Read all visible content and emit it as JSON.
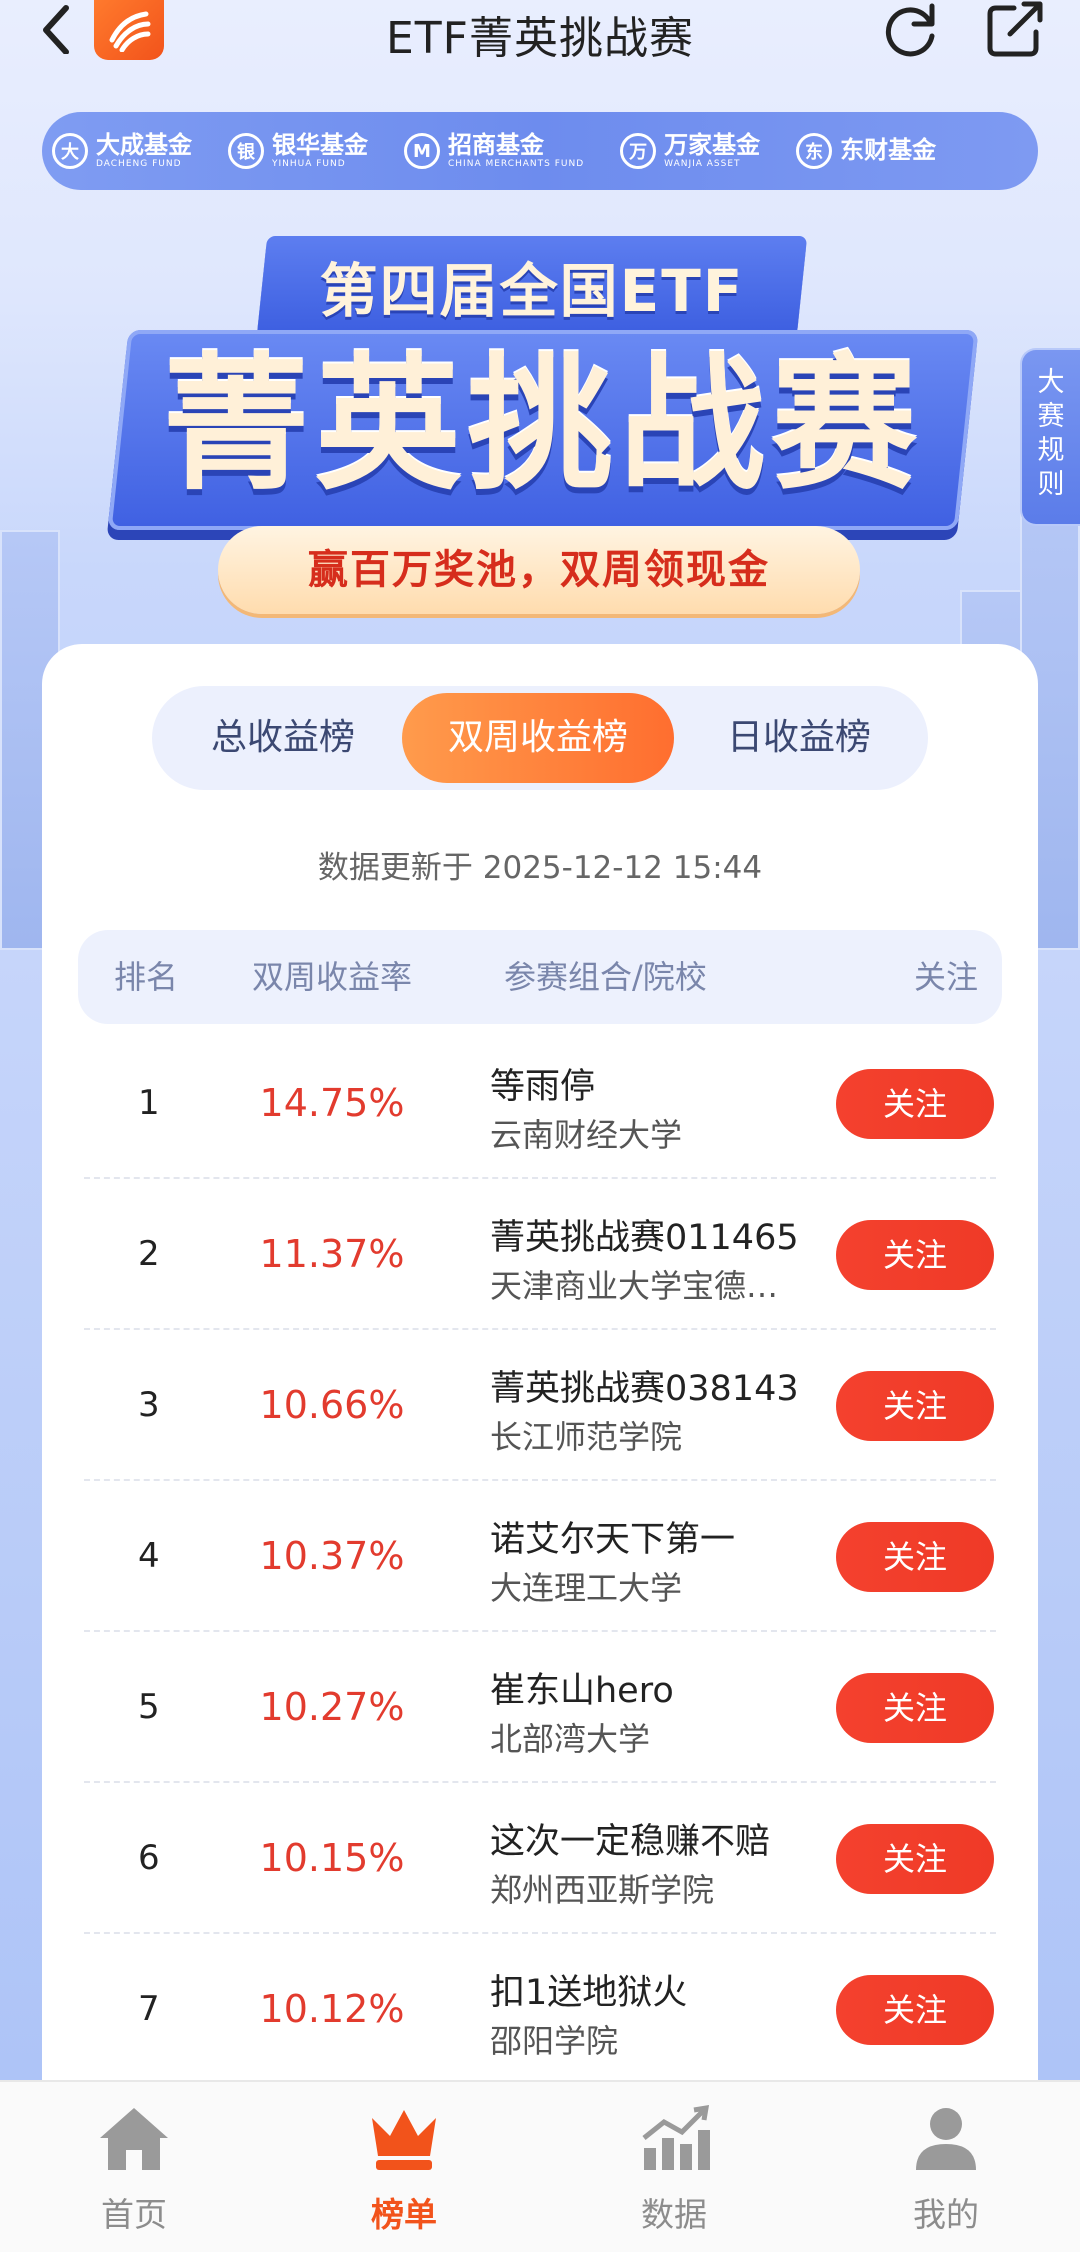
{
  "header": {
    "title": "ETF菁英挑战赛"
  },
  "sponsors": [
    {
      "cn": "大成基金",
      "en": "DACHENG FUND",
      "icon": "大"
    },
    {
      "cn": "银华基金",
      "en": "YINHUA FUND",
      "icon": "银"
    },
    {
      "cn": "招商基金",
      "en": "CHINA MERCHANTS FUND",
      "icon": "M"
    },
    {
      "cn": "万家基金",
      "en": "WANJIA ASSET",
      "icon": "万"
    },
    {
      "cn": "东财基金",
      "en": "",
      "icon": "东"
    }
  ],
  "banner": {
    "edition": "第四届全国ETF",
    "main": "菁英挑战赛",
    "slogan": "赢百万奖池，双周领现金",
    "rules_tab": "大赛规则"
  },
  "tabs": [
    {
      "label": "总收益榜",
      "active": false
    },
    {
      "label": "双周收益榜",
      "active": true
    },
    {
      "label": "日收益榜",
      "active": false
    }
  ],
  "update_note": "数据更新于 2025-12-12 15:44",
  "table": {
    "headers": {
      "rank": "排名",
      "return": "双周收益率",
      "team": "参赛组合/院校",
      "follow": "关注"
    },
    "rows": [
      {
        "rank": "1",
        "return": "14.75%",
        "team": "等雨停",
        "school": "云南财经大学",
        "follow": "关注"
      },
      {
        "rank": "2",
        "return": "11.37%",
        "team": "菁英挑战赛011465",
        "school": "天津商业大学宝德…",
        "follow": "关注"
      },
      {
        "rank": "3",
        "return": "10.66%",
        "team": "菁英挑战赛038143",
        "school": "长江师范学院",
        "follow": "关注"
      },
      {
        "rank": "4",
        "return": "10.37%",
        "team": "诺艾尔天下第一",
        "school": "大连理工大学",
        "follow": "关注"
      },
      {
        "rank": "5",
        "return": "10.27%",
        "team": "崔东山hero",
        "school": "北部湾大学",
        "follow": "关注"
      },
      {
        "rank": "6",
        "return": "10.15%",
        "team": "这次一定稳赚不赔",
        "school": "郑州西亚斯学院",
        "follow": "关注"
      },
      {
        "rank": "7",
        "return": "10.12%",
        "team": "扣1送地狱火",
        "school": "邵阳学院",
        "follow": "关注"
      }
    ]
  },
  "bottom_nav": [
    {
      "label": "首页",
      "icon": "home-icon",
      "active": false
    },
    {
      "label": "榜单",
      "icon": "crown-icon",
      "active": true
    },
    {
      "label": "数据",
      "icon": "chart-icon",
      "active": false
    },
    {
      "label": "我的",
      "icon": "user-icon",
      "active": false
    }
  ],
  "colors": {
    "accent": "#ff6e2f",
    "follow_button": "#f4412e",
    "return_text": "#e23b2e",
    "brand_blue": "#3f60e2"
  }
}
